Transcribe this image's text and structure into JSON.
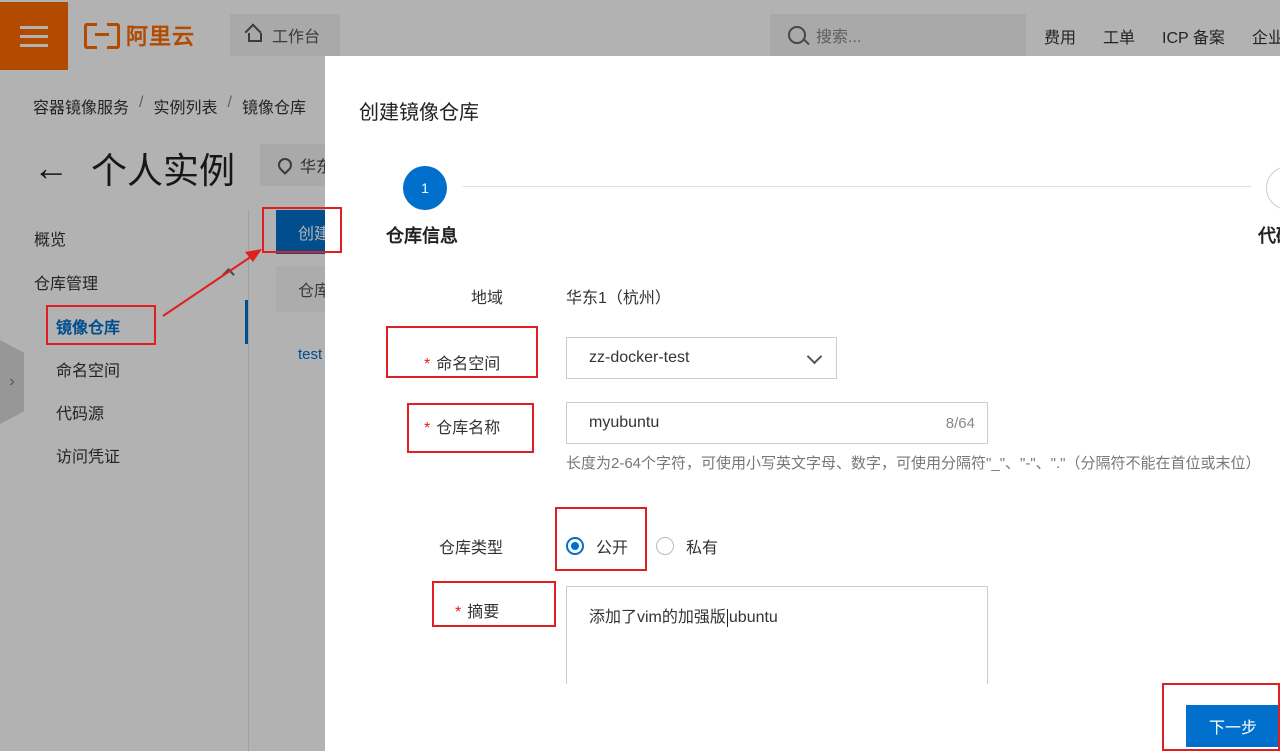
{
  "topbar": {
    "brand": "阿里云",
    "workbench": "工作台",
    "search_placeholder": "搜索...",
    "links": [
      "费用",
      "工单",
      "ICP 备案",
      "企业"
    ]
  },
  "background": {
    "breadcrumb": [
      "容器镜像服务",
      "实例列表",
      "镜像仓库"
    ],
    "page_title": "个人实例",
    "region_short": "华东",
    "nav": {
      "overview": "概览",
      "repo_mgmt": "仓库管理",
      "image_repo": "镜像仓库",
      "namespace": "命名空间",
      "code_source": "代码源",
      "access_credential": "访问凭证"
    },
    "create_button": "创建镜像仓库",
    "table_header": "仓库名称",
    "row_name": "test"
  },
  "drawer": {
    "title": "创建镜像仓库",
    "steps": [
      {
        "number": "1",
        "label": "仓库信息"
      },
      {
        "number": "",
        "label": "代码源"
      }
    ],
    "fields": {
      "region_label": "地域",
      "region_value": "华东1（杭州）",
      "required_mark": "*",
      "namespace_label": "命名空间",
      "namespace_value": "zz-docker-test",
      "repo_name_label": "仓库名称",
      "repo_name_value": "myubuntu",
      "repo_name_counter": "8/64",
      "repo_name_hint": "长度为2-64个字符，可使用小写英文字母、数字，可使用分隔符\"_\"、\"-\"、\".\"（分隔符不能在首位或末位）",
      "repo_type_label": "仓库类型",
      "repo_type_options": [
        "公开",
        "私有"
      ],
      "repo_type_selected": "公开",
      "summary_label": "摘要",
      "summary_value_before_caret": "添加了vim的加强版",
      "summary_value_after_caret": "ubuntu"
    },
    "next_button": "下一步"
  },
  "colors": {
    "brand_orange": "#ff6a00",
    "primary_blue": "#0070cc",
    "annotation_red": "#e02020"
  }
}
